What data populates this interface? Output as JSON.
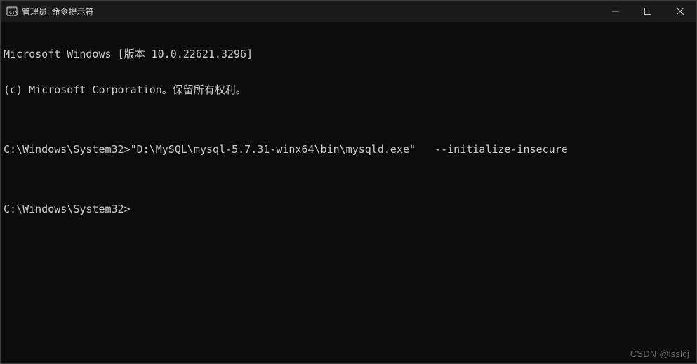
{
  "titlebar": {
    "title": "管理员: 命令提示符"
  },
  "terminal": {
    "lines": [
      "Microsoft Windows [版本 10.0.22621.3296]",
      "(c) Microsoft Corporation。保留所有权利。",
      "",
      "C:\\Windows\\System32>\"D:\\MySQL\\mysql-5.7.31-winx64\\bin\\mysqld.exe\"   --initialize-insecure",
      "",
      "C:\\Windows\\System32>"
    ]
  },
  "watermark": "CSDN @lsslcj"
}
